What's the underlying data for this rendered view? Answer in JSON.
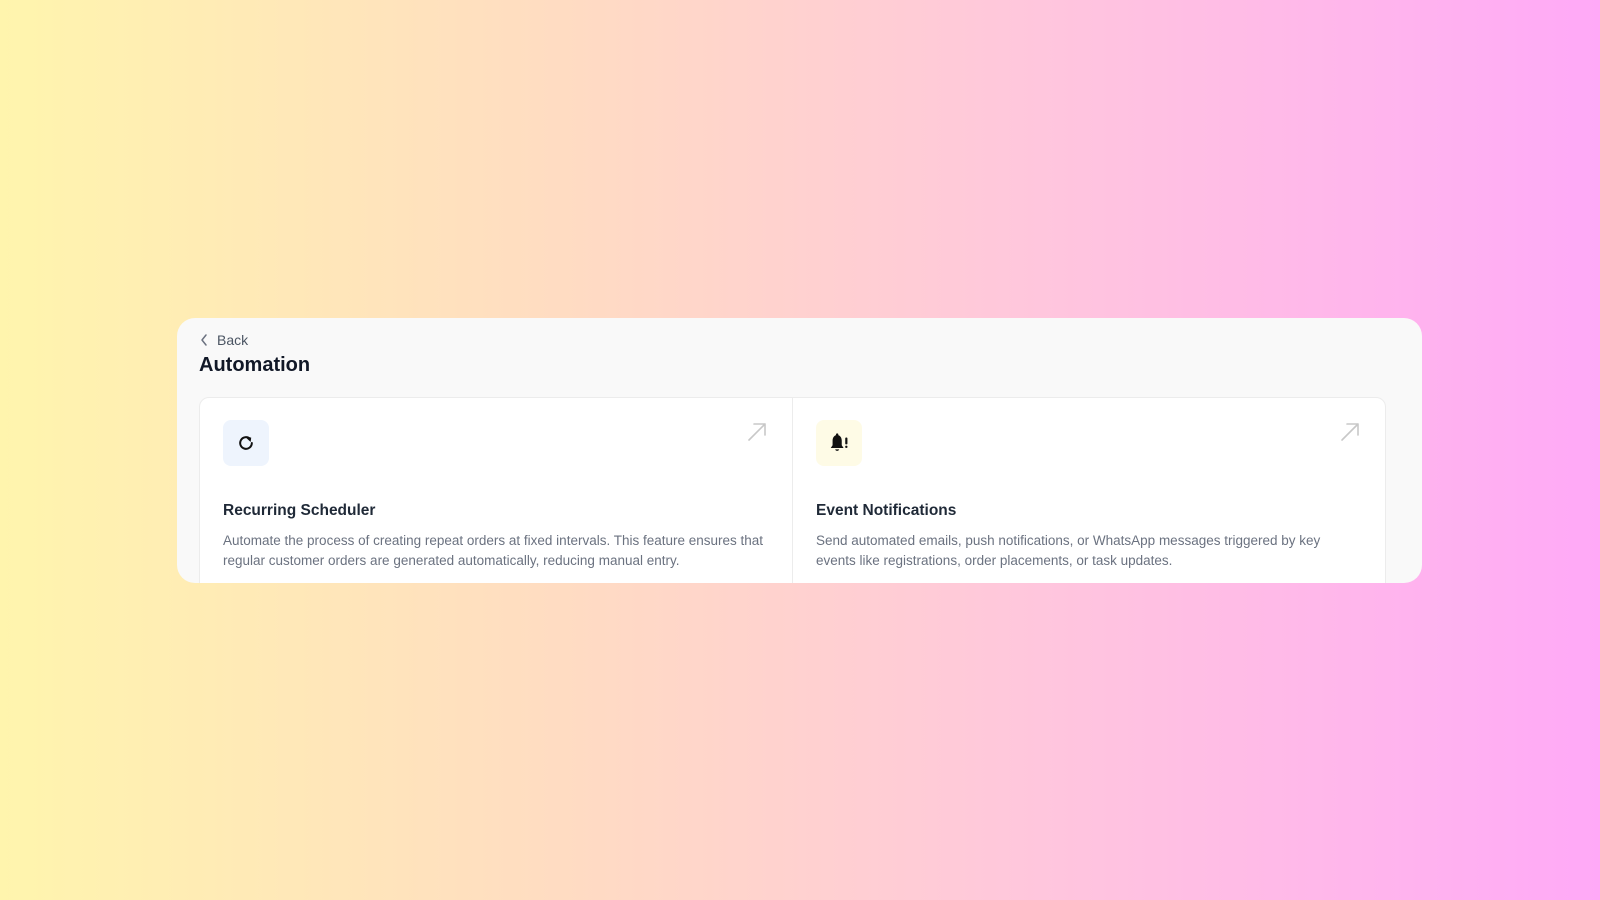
{
  "header": {
    "back_label": "Back",
    "title": "Automation"
  },
  "cards": [
    {
      "title": "Recurring Scheduler",
      "description": "Automate the process of creating repeat orders at fixed intervals. This feature ensures that regular customer orders are generated automatically, reducing manual entry.",
      "icon": "refresh-icon",
      "icon_bg": "#eef4fd"
    },
    {
      "title": "Event Notifications",
      "description": "Send automated emails, push notifications, or WhatsApp messages triggered by key events like registrations, order placements, or task updates.",
      "icon": "bell-alert-icon",
      "icon_bg": "#fefbe6"
    }
  ],
  "colors": {
    "gradient_start": "#fff5ad",
    "gradient_end": "#ffa9f7",
    "panel_bg": "#f9f9f9",
    "title_text": "#111827",
    "muted_text": "#6b7280"
  }
}
